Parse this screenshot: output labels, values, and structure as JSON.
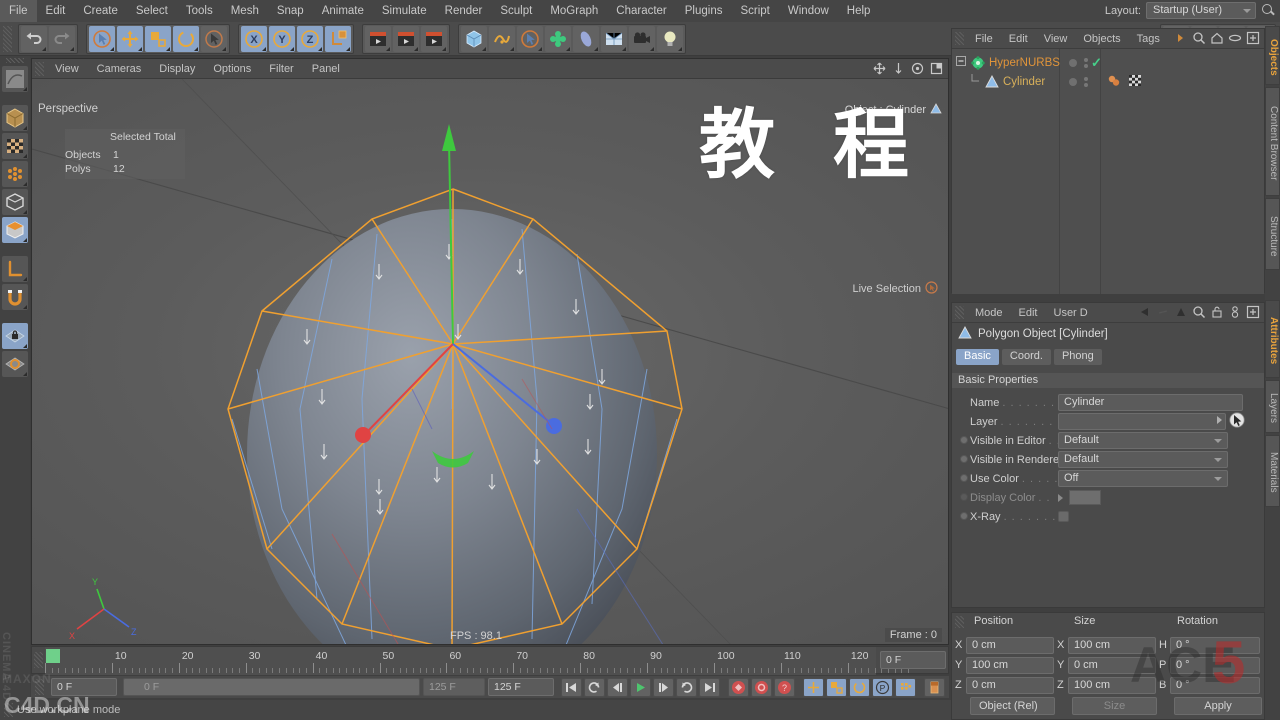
{
  "menubar": {
    "items": [
      "File",
      "Edit",
      "Create",
      "Select",
      "Tools",
      "Mesh",
      "Snap",
      "Animate",
      "Simulate",
      "Render",
      "Sculpt",
      "MoGraph",
      "Character",
      "Plugins",
      "Script",
      "Window",
      "Help"
    ],
    "layout_label": "Layout:",
    "layout_value": "Startup (User)",
    "search_icon": "search-icon"
  },
  "toolbar": {
    "groups": [
      {
        "name": "undo-redo",
        "buttons": [
          {
            "name": "undo-button",
            "glyph": "↶",
            "active": false
          },
          {
            "name": "redo-button",
            "glyph": "↷",
            "active": false
          }
        ]
      },
      {
        "name": "transform-tools",
        "buttons": [
          {
            "name": "live-selection-tool",
            "glyph": "◉",
            "active": true
          },
          {
            "name": "move-tool",
            "glyph": "✛",
            "active": true
          },
          {
            "name": "scale-tool",
            "glyph": "▣",
            "active": true
          },
          {
            "name": "rotate-tool",
            "glyph": "◯",
            "active": true
          },
          {
            "name": "cursor-tool",
            "glyph": "➤",
            "active": false
          }
        ]
      },
      {
        "name": "axis-locks",
        "buttons": [
          {
            "name": "x-axis-lock",
            "glyph": "X",
            "active": true
          },
          {
            "name": "y-axis-lock",
            "glyph": "Y",
            "active": true
          },
          {
            "name": "z-axis-lock",
            "glyph": "Z",
            "active": true
          },
          {
            "name": "world-object-coords",
            "glyph": "L",
            "active": true
          }
        ]
      },
      {
        "name": "render-tools",
        "buttons": [
          {
            "name": "render-view-button",
            "glyph": "🎬",
            "active": false
          },
          {
            "name": "render-region-button",
            "glyph": "🎬",
            "active": false
          },
          {
            "name": "render-settings-button",
            "glyph": "🎬",
            "active": false
          }
        ]
      },
      {
        "name": "object-primitives",
        "buttons": [
          {
            "name": "cube-primitive-button",
            "glyph": "◼",
            "active": false
          },
          {
            "name": "spline-button",
            "glyph": "∿",
            "active": false
          },
          {
            "name": "nurbs-button",
            "glyph": "◉",
            "active": false
          },
          {
            "name": "array-button",
            "glyph": "✿",
            "active": false
          },
          {
            "name": "deformer-button",
            "glyph": "◗",
            "active": false
          },
          {
            "name": "scene-button",
            "glyph": "▦",
            "active": false
          },
          {
            "name": "camera-button",
            "glyph": "🎥",
            "active": false
          },
          {
            "name": "light-button",
            "glyph": "💡",
            "active": false
          }
        ]
      },
      {
        "name": "view-utilities",
        "buttons": [
          {
            "name": "content-browser-button",
            "glyph": "☕",
            "active": false
          },
          {
            "name": "notes-button",
            "glyph": "📄",
            "active": false
          },
          {
            "name": "material-button",
            "glyph": "◕",
            "active": false
          },
          {
            "name": "script-button",
            "glyph": "📋",
            "active": false
          }
        ]
      }
    ]
  },
  "left_palette": {
    "items": [
      {
        "name": "make-editable-button",
        "glyph": "⬔",
        "active": false
      },
      {
        "name": "model-mode-button",
        "glyph": "◻",
        "active": false
      },
      {
        "name": "texture-mode-button",
        "glyph": "▦",
        "active": false
      },
      {
        "name": "points-mode-button",
        "glyph": "⬩",
        "active": false
      },
      {
        "name": "edges-mode-button",
        "glyph": "◰",
        "active": false
      },
      {
        "name": "polygons-mode-button",
        "glyph": "◩",
        "active": true
      },
      {
        "name": "axis-modification-button",
        "glyph": "⌐",
        "active": false
      },
      {
        "name": "enable-snap-button",
        "glyph": "∪",
        "active": false
      },
      {
        "name": "workplane-lock-button",
        "glyph": "▧",
        "active": true
      },
      {
        "name": "workplane-button",
        "glyph": "▨",
        "active": false
      }
    ]
  },
  "viewport": {
    "menu": [
      "View",
      "Cameras",
      "Display",
      "Options",
      "Filter",
      "Panel"
    ],
    "camera_label": "Perspective",
    "stats": {
      "header_selected": "Selected",
      "header_total": "Total",
      "row_objects_label": "Objects",
      "row_objects_value": "1",
      "row_polys_label": "Polys",
      "row_polys_value": "12"
    },
    "object_tag": "Object : Cylinder",
    "tool_tag": "Live Selection",
    "fps": "FPS : 98.1",
    "frame": "Frame : 0",
    "overlay_text_1": "教",
    "overlay_text_2": "程",
    "nav_icons": [
      "pan-icon",
      "dolly-icon",
      "orbit-icon",
      "maximize-icon"
    ],
    "axis_labels": {
      "y": "Y",
      "x": "X",
      "z": "Z"
    },
    "wireframe_color": "#f0a030",
    "hypernurbs_cage_color": "#7fa8e0"
  },
  "timeline": {
    "ticks": [
      "0",
      "10",
      "20",
      "30",
      "40",
      "50",
      "60",
      "70",
      "80",
      "90",
      "100",
      "110",
      "120"
    ],
    "current_frame_field": "0 F"
  },
  "animbar": {
    "current_frame": "0 F",
    "slider_value": "0 F",
    "end_frame_readonly": "125 F",
    "end_frame_field": "125 F",
    "transport": [
      {
        "name": "go-to-start-button",
        "glyph": "|◀"
      },
      {
        "name": "previous-key-button",
        "glyph": "↺"
      },
      {
        "name": "step-back-button",
        "glyph": "◁|"
      },
      {
        "name": "play-button",
        "glyph": "▶"
      },
      {
        "name": "step-forward-button",
        "glyph": "|▷"
      },
      {
        "name": "next-key-button",
        "glyph": "↻"
      },
      {
        "name": "go-to-end-button",
        "glyph": "▶|"
      }
    ],
    "record": [
      {
        "name": "record-active-objects-button",
        "glyph": "◉"
      },
      {
        "name": "autokeying-button",
        "glyph": "◎"
      },
      {
        "name": "keyframe-selection-button",
        "glyph": "?"
      }
    ],
    "keyframe_toggles": [
      {
        "name": "position-key-toggle",
        "glyph": "✛",
        "active": true
      },
      {
        "name": "scale-key-toggle",
        "glyph": "▣",
        "active": true
      },
      {
        "name": "rotation-key-toggle",
        "glyph": "◯",
        "active": true
      },
      {
        "name": "parameter-key-toggle",
        "glyph": "P",
        "active": true
      },
      {
        "name": "pla-key-toggle",
        "glyph": "▦",
        "active": true
      }
    ],
    "level_of_detail": {
      "name": "level-of-detail-button",
      "glyph": "▯"
    }
  },
  "statusbar": {
    "text": "Use workplane mode"
  },
  "objects_panel": {
    "menu": [
      "File",
      "Edit",
      "View",
      "Objects",
      "Tags"
    ],
    "more_icon": "chevron-right-icon",
    "icons": [
      "search-icon",
      "home-icon",
      "link-icon",
      "new-window-icon"
    ],
    "tree": [
      {
        "name": "HyperNURBS",
        "icon": "hypernurbs-icon",
        "color": "#e0943a",
        "indent": 0,
        "expander": "collapse-icon",
        "visible_dots": 2,
        "check": "✓",
        "tags": []
      },
      {
        "name": "Cylinder",
        "icon": "polygon-object-icon",
        "color": "#d8b05a",
        "indent": 1,
        "expander": "",
        "visible_dots": 2,
        "check": "",
        "tags": [
          "phong-tag",
          "texture-tag"
        ]
      }
    ]
  },
  "attributes_panel": {
    "menu": [
      "Mode",
      "Edit",
      "User D"
    ],
    "icons": [
      "back-arrow-icon",
      "forward-arrow-icon",
      "up-arrow-icon",
      "search-icon",
      "lock-icon",
      "pin-icon",
      "new-window-icon"
    ],
    "object_title": "Polygon Object [Cylinder]",
    "object_icon": "polygon-object-icon",
    "tabs": [
      {
        "label": "Basic",
        "active": true
      },
      {
        "label": "Coord.",
        "active": false
      },
      {
        "label": "Phong",
        "active": false
      }
    ],
    "section_title": "Basic Properties",
    "properties": [
      {
        "label": "Name",
        "dots": ". . . . . . . . . . . .",
        "value": "Cylinder",
        "type": "text",
        "dim": false
      },
      {
        "label": "Layer",
        "dots": ". . . . . . . . . . . . .",
        "value": "",
        "type": "layer",
        "dim": false
      },
      {
        "label": "Visible in Editor",
        "dots": ". . .",
        "value": "Default",
        "type": "combo",
        "dim": false
      },
      {
        "label": "Visible in Renderer",
        "dots": "",
        "value": "Default",
        "type": "combo",
        "dim": false
      },
      {
        "label": "Use Color",
        "dots": ". . . . . . . .",
        "value": "Off",
        "type": "combo",
        "dim": false
      },
      {
        "label": "Display Color",
        "dots": ". .",
        "value": "",
        "type": "color",
        "dim": true
      },
      {
        "label": "X-Ray",
        "dots": ". . . . . . . . . . .",
        "value": "",
        "type": "check",
        "dim": false
      }
    ]
  },
  "coordinates_panel": {
    "headers": [
      "Position",
      "Size",
      "Rotation"
    ],
    "rows": [
      {
        "pos_axis": "X",
        "pos_value": "0 cm",
        "size_axis": "X",
        "size_value": "100 cm",
        "rot_axis": "H",
        "rot_value": "0 °"
      },
      {
        "pos_axis": "Y",
        "pos_value": "100 cm",
        "size_axis": "Y",
        "size_value": "0 cm",
        "rot_axis": "P",
        "rot_value": "0 °"
      },
      {
        "pos_axis": "Z",
        "pos_value": "0 cm",
        "size_axis": "Z",
        "size_value": "100 cm",
        "rot_axis": "B",
        "rot_value": "0 °"
      }
    ],
    "mode_select": "Object (Rel)",
    "size_select": "Size",
    "apply_button": "Apply"
  },
  "vertical_tabs": {
    "top": [
      {
        "label": "Objects",
        "active": true
      },
      {
        "label": "Content Browser",
        "active": false
      },
      {
        "label": "Structure",
        "active": false
      }
    ],
    "bottom": [
      {
        "label": "Attributes",
        "active": true
      },
      {
        "label": "Layers",
        "active": false
      },
      {
        "label": "Materials",
        "active": false
      }
    ]
  },
  "watermarks": {
    "maxon": "MAXON",
    "cinema4d": "CINEMA 4D",
    "site": "C4D.CN",
    "ace": "ACE",
    "ace_num": "5"
  }
}
